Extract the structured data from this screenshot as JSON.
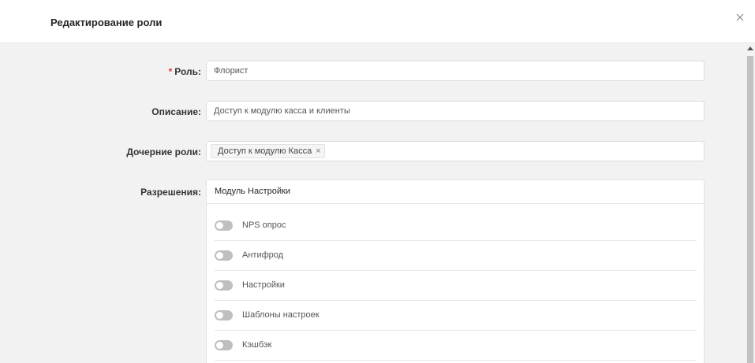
{
  "dialog": {
    "title": "Редактирование роли",
    "close_icon": "close-icon"
  },
  "form": {
    "role": {
      "label": "Роль:",
      "required_mark": "*",
      "value": "Флорист"
    },
    "description": {
      "label": "Описание:",
      "value": "Доступ к модулю касса и клиенты"
    },
    "child_roles": {
      "label": "Дочерние роли:",
      "tags": [
        {
          "label": "Доступ к модулю Касса",
          "remove": "×"
        }
      ]
    },
    "permissions": {
      "label": "Разрешения:",
      "module_title": "Модуль Настройки",
      "items": [
        {
          "label": "NPS опрос",
          "enabled": false
        },
        {
          "label": "Антифрод",
          "enabled": false
        },
        {
          "label": "Настройки",
          "enabled": false
        },
        {
          "label": "Шаблоны настроек",
          "enabled": false
        },
        {
          "label": "Кэшбэк",
          "enabled": false
        }
      ]
    }
  },
  "colors": {
    "required": "#e5383b",
    "toggle_off": "#bfbfbf",
    "background": "#f2f2f2"
  }
}
